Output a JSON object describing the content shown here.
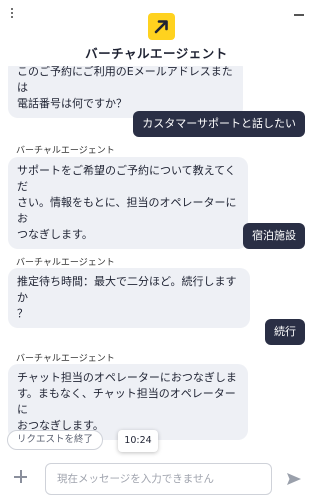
{
  "header": {
    "title": "バーチャルエージェント",
    "menu_icon": "kebab-menu-icon",
    "minimize_icon": "minimize-icon",
    "logo_icon": "arrow-logo-icon",
    "logo_color": "#ffd21f"
  },
  "messages": [
    {
      "role": "bot",
      "lines": [
        "このご予約にご利用のEメールアドレスまたは",
        "電話番号は何ですか？"
      ]
    },
    {
      "role": "user",
      "text": "カスタマーサポートと話したい"
    },
    {
      "role": "bot",
      "sender": "バーチャルエージェント",
      "lines": [
        "サポートをご希望のご予約について教えてくだ",
        "さい。情報をもとに、担当のオペレーターにお",
        "つなぎします。"
      ]
    },
    {
      "role": "user",
      "text": "宿泊施設"
    },
    {
      "role": "bot",
      "sender": "バーチャルエージェント",
      "lines": [
        "推定待ち時間：最大で二分ほど。続行しますか",
        "？"
      ]
    },
    {
      "role": "user",
      "text": "続行"
    },
    {
      "role": "bot",
      "sender": "バーチャルエージェント",
      "lines": [
        "チャット担当のオペレーターにおつなぎしま",
        "す。まもなく、チャット担当のオペレーターに",
        "おつなぎします。"
      ]
    }
  ],
  "footer": {
    "end_request_label": "リクエストを終了",
    "timestamp": "10:24"
  },
  "composer": {
    "placeholder": "現在メッセージを入力できません",
    "add_icon": "plus-icon",
    "send_icon": "send-icon"
  },
  "colors": {
    "user_bubble": "#2a2f45",
    "bot_bubble": "#eef0f5"
  }
}
